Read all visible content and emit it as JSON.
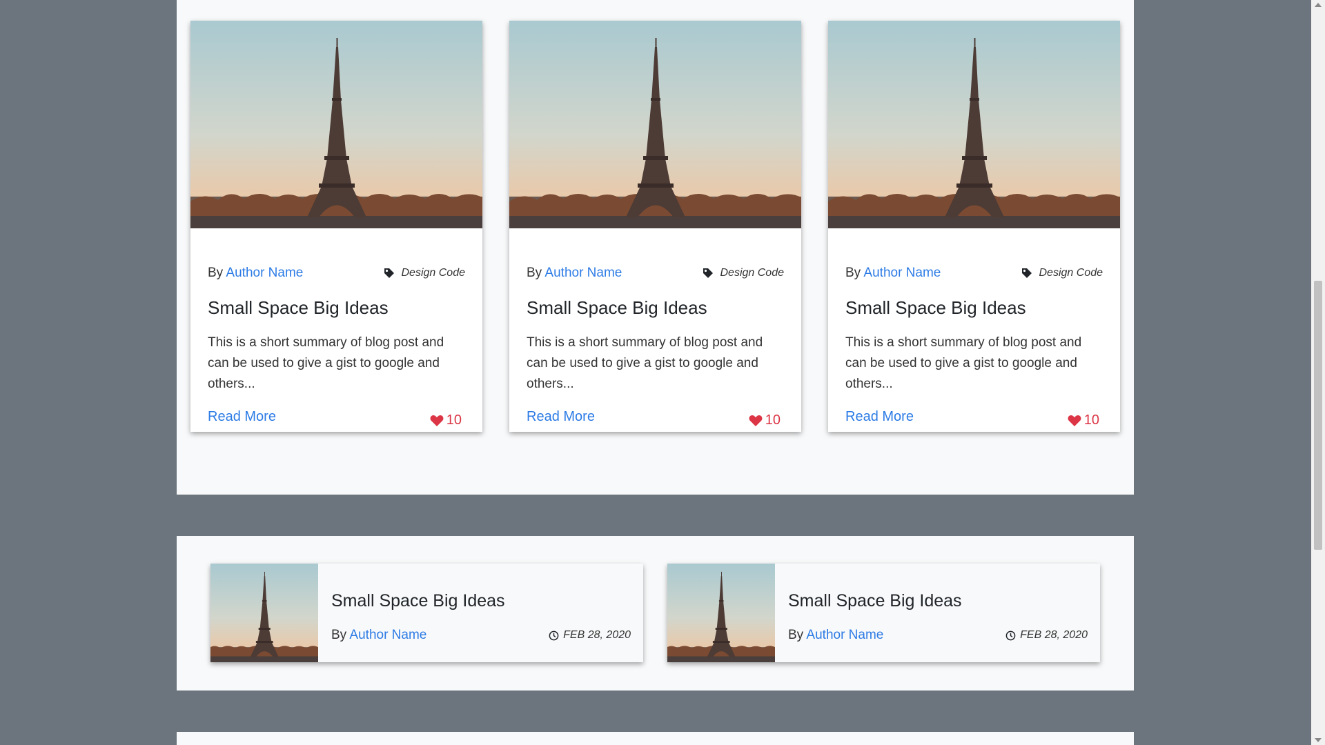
{
  "colors": {
    "accent": "#2c7be5",
    "heart": "#dc3545",
    "page_bg": "#6c757d",
    "section_bg": "#f8f9fa"
  },
  "posts": [
    {
      "by_label": "By",
      "author": "Author Name",
      "tag": "Design Code",
      "title": "Small Space Big Ideas",
      "summary": "This is a short summary of blog post and can be used to give a gist to google and others...",
      "read_more": "Read More",
      "likes": "10",
      "image": "eiffel-tower-image"
    },
    {
      "by_label": "By",
      "author": "Author Name",
      "tag": "Design Code",
      "title": "Small Space Big Ideas",
      "summary": "This is a short summary of blog post and can be used to give a gist to google and others...",
      "read_more": "Read More",
      "likes": "10",
      "image": "eiffel-tower-image"
    },
    {
      "by_label": "By",
      "author": "Author Name",
      "tag": "Design Code",
      "title": "Small Space Big Ideas",
      "summary": "This is a short summary of blog post and can be used to give a gist to google and others...",
      "read_more": "Read More",
      "likes": "10",
      "image": "eiffel-tower-image"
    }
  ],
  "recent_posts": [
    {
      "title": "Small Space Big Ideas",
      "by_label": "By",
      "author": "Author Name",
      "date": "FEB 28, 2020",
      "image": "eiffel-tower-image"
    },
    {
      "title": "Small Space Big Ideas",
      "by_label": "By",
      "author": "Author Name",
      "date": "FEB 28, 2020",
      "image": "eiffel-tower-image"
    }
  ]
}
